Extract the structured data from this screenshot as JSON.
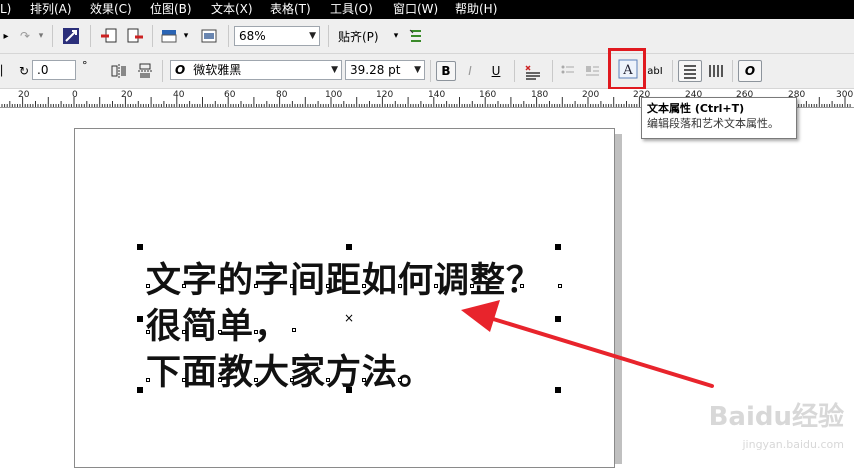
{
  "menu": [
    "L)",
    "排列(A)",
    "效果(C)",
    "位图(B)",
    "文本(X)",
    "表格(T)",
    "工具(O)",
    "窗口(W)",
    "帮助(H)"
  ],
  "toolbar1": {
    "zoom_value": "68%",
    "snap_label": "贴齐(P)"
  },
  "toolbar2": {
    "angle_value": ".0",
    "angle_unit": "°",
    "font_name": "微软雅黑",
    "font_size": "39.28 pt"
  },
  "ruler_labels": [
    "20",
    "0",
    "20",
    "40",
    "60",
    "80",
    "100",
    "120",
    "140",
    "160",
    "180",
    "200",
    "220",
    "240",
    "260",
    "280",
    "300"
  ],
  "canvas_text": {
    "line1": "文字的字间距如何调整？",
    "line2": "很简单，",
    "line3": "下面教大家方法。"
  },
  "tooltip": {
    "title": "文本属性 (Ctrl+T)",
    "description": "编辑段落和艺术文本属性。"
  },
  "watermark": {
    "brand": "Baidu经验",
    "url": "jingyan.baidu.com"
  },
  "colors": {
    "menubar": "#000000",
    "toolbar": "#efefef",
    "highlight": "#e0191f",
    "arrow": "#e8242c"
  }
}
